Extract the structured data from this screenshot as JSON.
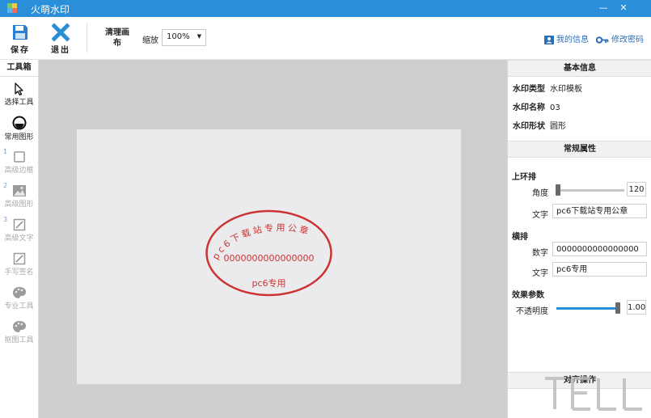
{
  "window": {
    "title": "火萌水印"
  },
  "toolbar": {
    "save_label": "保存",
    "exit_label": "退出",
    "clear_label": "清理画布",
    "zoom_label": "缩放",
    "zoom_value": "100%",
    "my_info_label": "我的信息",
    "change_password_label": "修改密码"
  },
  "toolbox": {
    "title": "工具箱",
    "tools": [
      {
        "label": "选择工具",
        "icon": "cursor-icon",
        "enabled": true
      },
      {
        "label": "常用图形",
        "icon": "circle-shape-icon",
        "enabled": true
      },
      {
        "num": "1",
        "label": "高级边框",
        "icon": "border-icon",
        "enabled": false
      },
      {
        "num": "2",
        "label": "高级图形",
        "icon": "image-icon",
        "enabled": false
      },
      {
        "num": "3",
        "label": "高级文字",
        "icon": "text-edit-icon",
        "enabled": false
      },
      {
        "label": "手写签名",
        "icon": "pen-icon",
        "enabled": false
      },
      {
        "label": "专业工具",
        "icon": "palette-icon",
        "enabled": false
      },
      {
        "label": "抠图工具",
        "icon": "palette-icon",
        "enabled": false
      }
    ]
  },
  "stamp": {
    "arc_text": "pc6下载站专用公章",
    "number_text": "0000000000000000",
    "bottom_text": "pc6专用",
    "color": "#cc3333"
  },
  "basic_info": {
    "title": "基本信息",
    "type_label": "水印类型",
    "type_value": "水印模板",
    "name_label": "水印名称",
    "name_value": "03",
    "shape_label": "水印形状",
    "shape_value": "圆形"
  },
  "props": {
    "title": "常规属性",
    "upper_ring": {
      "title": "上环排",
      "angle_label": "角度",
      "angle_value": "120",
      "text_label": "文字",
      "text_value": "pc6下载站专用公章"
    },
    "horizontal": {
      "title": "横排",
      "number_label": "数字",
      "number_value": "0000000000000000",
      "text_label": "文字",
      "text_value": "pc6专用"
    },
    "effect": {
      "title": "效果参数",
      "opacity_label": "不透明度",
      "opacity_value": "1.00",
      "opacity_level": 1.0
    }
  },
  "align": {
    "title": "对齐操作"
  },
  "colors": {
    "accent": "#2a8fd8",
    "titlebar": "#2a8fd8",
    "stamp": "#cc3333"
  }
}
